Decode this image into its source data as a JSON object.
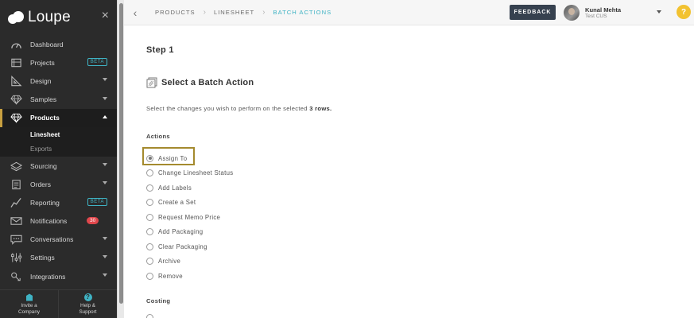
{
  "app": {
    "name": "Loupe",
    "close_symbol": "×"
  },
  "sidebar": {
    "items": [
      {
        "label": "Dashboard",
        "icon": "dashboard-icon"
      },
      {
        "label": "Projects",
        "badge": "BETA",
        "icon": "projects-icon"
      },
      {
        "label": "Design",
        "icon": "design-icon",
        "chevron": "down"
      },
      {
        "label": "Samples",
        "icon": "diamond-icon",
        "chevron": "down"
      },
      {
        "label": "Products",
        "icon": "diamond-icon",
        "chevron": "up",
        "active": true
      },
      {
        "label": "Sourcing",
        "icon": "sourcing-icon",
        "chevron": "down"
      },
      {
        "label": "Orders",
        "icon": "orders-icon",
        "chevron": "down"
      },
      {
        "label": "Reporting",
        "badge": "BETA",
        "icon": "reporting-icon"
      },
      {
        "label": "Notifications",
        "count": "30",
        "icon": "envelope-icon"
      },
      {
        "label": "Conversations",
        "icon": "chat-icon",
        "chevron": "down"
      },
      {
        "label": "Settings",
        "icon": "sliders-icon",
        "chevron": "down"
      },
      {
        "label": "Integrations",
        "icon": "integrations-icon",
        "chevron": "down"
      }
    ],
    "products_sub": [
      {
        "label": "Linesheet",
        "active": true
      },
      {
        "label": "Exports"
      }
    ],
    "footer": {
      "invite_line1": "Invite a",
      "invite_line2": "Company",
      "help_line1": "Help &",
      "help_line2": "Support",
      "help_symbol": "?"
    }
  },
  "topbar": {
    "back_symbol": "‹",
    "breadcrumbs": [
      "PRODUCTS",
      "LINESHEET",
      "BATCH ACTIONS"
    ],
    "separator": "›",
    "feedback_label": "FEEDBACK",
    "user_name": "Kunal Mehta",
    "user_org": "Test CUS",
    "help_symbol": "?"
  },
  "main": {
    "step_title": "Step 1",
    "section_title": "Select a Batch Action",
    "desc_prefix": "Select the changes you wish to perform on the selected",
    "desc_count": "3 rows.",
    "actions_label": "Actions",
    "actions": [
      {
        "label": "Assign To",
        "checked": true
      },
      {
        "label": "Change Linesheet Status"
      },
      {
        "label": "Add Labels"
      },
      {
        "label": "Create a Set"
      },
      {
        "label": "Request Memo Price"
      },
      {
        "label": "Add Packaging"
      },
      {
        "label": "Clear Packaging"
      },
      {
        "label": "Archive"
      },
      {
        "label": "Remove"
      }
    ],
    "costing_label": "Costing"
  },
  "colors": {
    "sidebar_bg": "#2b2b2b",
    "accent_teal": "#3fb3c4",
    "active_bar": "#c8a040",
    "highlight_border": "#a48a2e",
    "feedback_bg": "#36414f",
    "help_yellow": "#f2c230",
    "badge_red": "#e0474c"
  }
}
